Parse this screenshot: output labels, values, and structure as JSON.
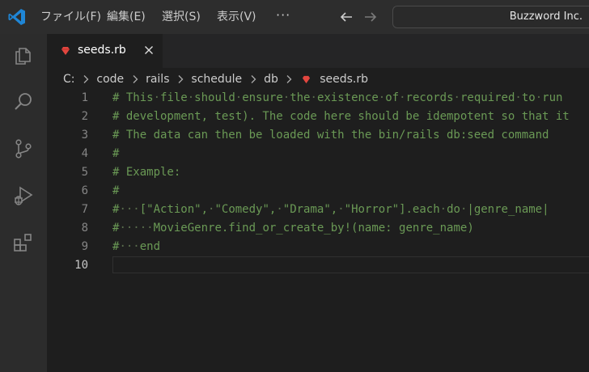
{
  "menu": [
    {
      "label": "ファイル(F)"
    },
    {
      "label": "編集(E)"
    },
    {
      "label": "選択(S)"
    },
    {
      "label": "表示(V)"
    }
  ],
  "menu_more": "···",
  "search": {
    "text": "Buzzword Inc."
  },
  "tab": {
    "label": "seeds.rb"
  },
  "breadcrumb": {
    "drive": "C:",
    "parts": [
      "code",
      "rails",
      "schedule",
      "db"
    ],
    "file": "seeds.rb"
  },
  "editor": {
    "lines": [
      {
        "num": "1",
        "segs": [
          [
            "# ",
            "t"
          ],
          [
            "This",
            "t"
          ],
          [
            "·",
            "w"
          ],
          [
            "file",
            "t"
          ],
          [
            "·",
            "w"
          ],
          [
            "should",
            "t"
          ],
          [
            "·",
            "w"
          ],
          [
            "ensure",
            "t"
          ],
          [
            "·",
            "w"
          ],
          [
            "the",
            "t"
          ],
          [
            "·",
            "w"
          ],
          [
            "existence",
            "t"
          ],
          [
            "·",
            "w"
          ],
          [
            "of",
            "t"
          ],
          [
            "·",
            "w"
          ],
          [
            "records",
            "t"
          ],
          [
            "·",
            "w"
          ],
          [
            "required",
            "t"
          ],
          [
            "·",
            "w"
          ],
          [
            "to",
            "t"
          ],
          [
            "·",
            "w"
          ],
          [
            "run",
            "t"
          ]
        ]
      },
      {
        "num": "2",
        "segs": [
          [
            "# development, test). The code here should be idempotent so that it",
            "t"
          ]
        ]
      },
      {
        "num": "3",
        "segs": [
          [
            "# The data can then be loaded with the bin/rails db:seed command",
            "t"
          ]
        ]
      },
      {
        "num": "4",
        "segs": [
          [
            "#",
            "t"
          ]
        ]
      },
      {
        "num": "5",
        "segs": [
          [
            "# Example:",
            "t"
          ]
        ]
      },
      {
        "num": "6",
        "segs": [
          [
            "#",
            "t"
          ]
        ]
      },
      {
        "num": "7",
        "segs": [
          [
            "#",
            "t"
          ],
          [
            "···",
            "w"
          ],
          [
            "[\"Action\",",
            "t"
          ],
          [
            "·",
            "w"
          ],
          [
            "\"Comedy\",",
            "t"
          ],
          [
            "·",
            "w"
          ],
          [
            "\"Drama\",",
            "t"
          ],
          [
            "·",
            "w"
          ],
          [
            "\"Horror\"].each",
            "t"
          ],
          [
            "·",
            "w"
          ],
          [
            "do",
            "t"
          ],
          [
            "·",
            "w"
          ],
          [
            "|genre_name|",
            "t"
          ]
        ]
      },
      {
        "num": "8",
        "segs": [
          [
            "#",
            "t"
          ],
          [
            "·····",
            "w"
          ],
          [
            "MovieGenre.find_or_create_by!(name: genre_name)",
            "t"
          ]
        ]
      },
      {
        "num": "9",
        "segs": [
          [
            "#",
            "t"
          ],
          [
            "···",
            "w"
          ],
          [
            "end",
            "t"
          ]
        ]
      },
      {
        "num": "10",
        "segs": []
      }
    ]
  }
}
